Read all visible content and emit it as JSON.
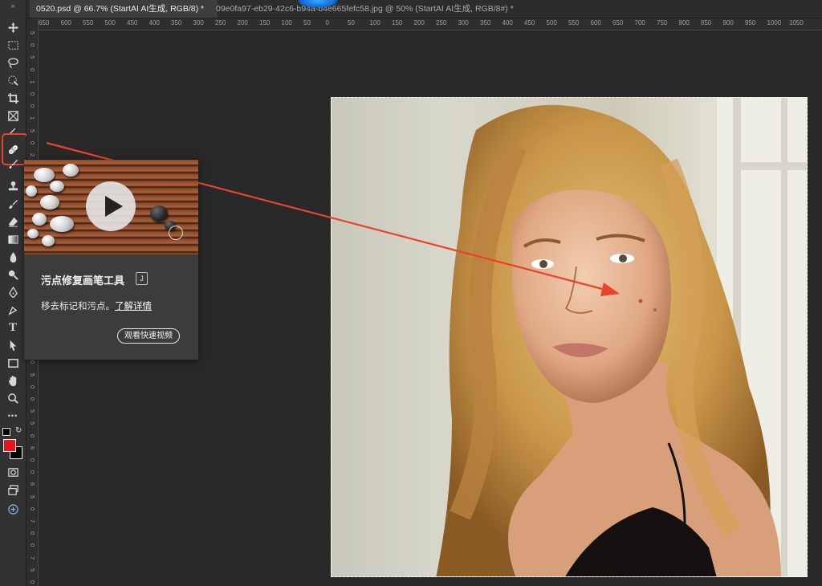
{
  "tabs": [
    {
      "label": "0520.psd @ 66.7% (StartAI AI生成, RGB/8) *",
      "active": true
    },
    {
      "label": "09e0fa97-eb29-42c6-b94a-b4e665fefc58.jpg @ 50% (StartAI AI生成, RGB/8#) *",
      "active": false
    }
  ],
  "ruler_top": [
    "650",
    "600",
    "550",
    "500",
    "450",
    "400",
    "350",
    "300",
    "250",
    "200",
    "150",
    "100",
    "50",
    "0",
    "50",
    "100",
    "150",
    "200",
    "250",
    "300",
    "350",
    "400",
    "450",
    "500",
    "550",
    "600",
    "650",
    "700",
    "750",
    "800",
    "850",
    "900",
    "950",
    "1000",
    "1050"
  ],
  "ruler_left": [
    "5",
    "0",
    "5",
    "0",
    "1",
    "0",
    "0",
    "1",
    "5",
    "0",
    "2",
    "0",
    "0",
    "2",
    "5",
    "0",
    "3",
    "0",
    "0",
    "3",
    "5",
    "0",
    "4",
    "0",
    "0",
    "4",
    "5",
    "0",
    "5",
    "0",
    "0",
    "5",
    "5",
    "0",
    "6",
    "0",
    "0",
    "6",
    "5",
    "0",
    "7",
    "0",
    "0",
    "7",
    "5",
    "0"
  ],
  "toolbar": {
    "collapse_label": "»",
    "tools": [
      "move-icon",
      "marquee-icon",
      "lasso-icon",
      "quick-select-icon",
      "crop-icon",
      "frame-icon",
      "eyedropper-icon",
      "spot-healing-brush-icon",
      "brush-icon",
      "clone-stamp-icon",
      "history-brush-icon",
      "eraser-icon",
      "gradient-icon",
      "blur-icon",
      "dodge-icon",
      "pen-icon",
      "type-icon",
      "path-select-icon",
      "rectangle-icon",
      "hand-icon",
      "zoom-icon",
      "more-icon"
    ],
    "type_tool_label": "T",
    "more_label": "•••",
    "foreground_color": "#e8141c",
    "background_color": "#000000"
  },
  "tooltip": {
    "title": "污点修复画笔工具",
    "shortcut": "J",
    "description": "移去标记和污点。",
    "learn_more": "了解详情",
    "video_button": "观看快速视频"
  },
  "annotation": {
    "highlight_color": "#e8442c",
    "arrow_color": "#e8442c"
  }
}
